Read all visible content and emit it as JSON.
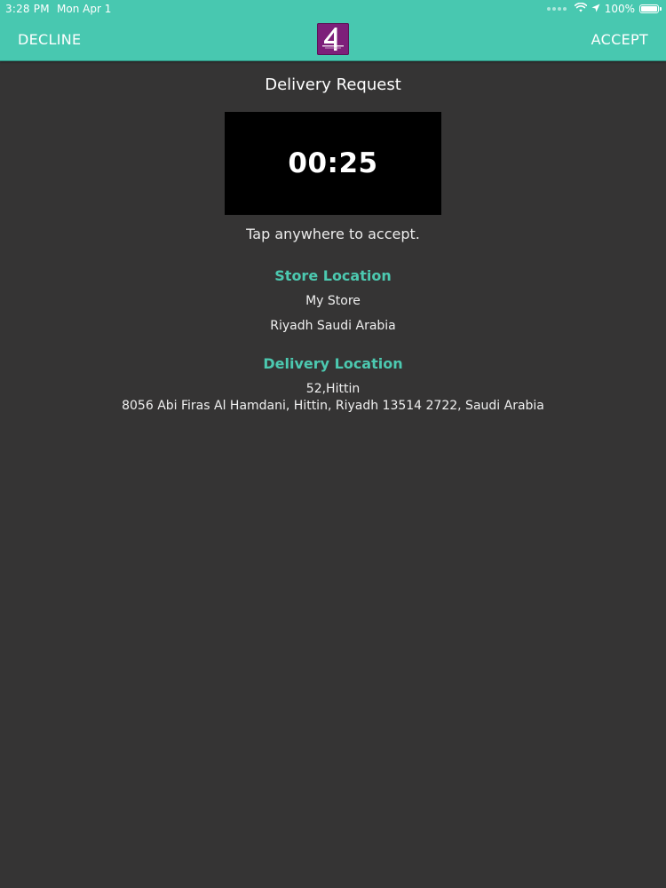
{
  "status_bar": {
    "time": "3:28 PM",
    "date": "Mon Apr 1",
    "battery_percent": "100%",
    "battery_level": 1.0,
    "icons": [
      "wifi-icon",
      "location-arrow-icon",
      "battery-icon"
    ]
  },
  "header": {
    "decline_label": "DECLINE",
    "accept_label": "ACCEPT",
    "logo_glyph": "4",
    "logo_color": "#7d1f7a",
    "bar_color": "#48c8b0"
  },
  "request": {
    "title": "Delivery Request",
    "timer": "00:25",
    "hint": "Tap anywhere to accept."
  },
  "store_location": {
    "heading": "Store  Location",
    "name": "My Store",
    "city": "Riyadh Saudi Arabia"
  },
  "delivery_location": {
    "heading": "Delivery Location",
    "line1": "52,Hittin",
    "line2": "8056 Abi Firas Al Hamdani,  Hittin,  Riyadh 13514 2722,  Saudi Arabia"
  },
  "colors": {
    "accent": "#4cc9b0",
    "background": "#353434",
    "timer_background": "#000000"
  }
}
